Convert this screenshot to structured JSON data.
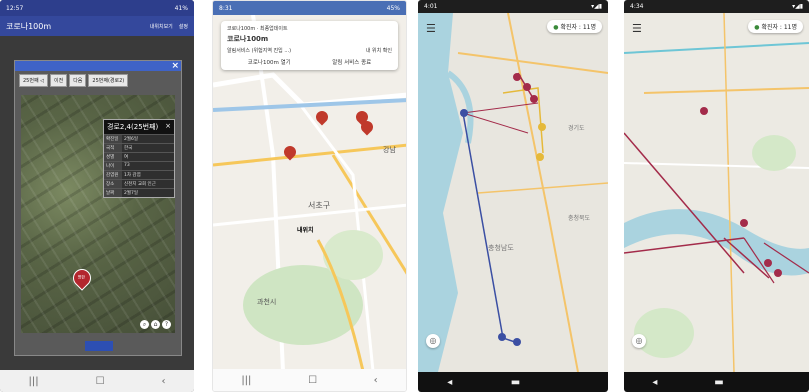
{
  "phone1": {
    "status_time": "12:57",
    "status_right": "41%",
    "app_title": "코로나100m",
    "menu_items": [
      "내위치보기",
      "설정"
    ],
    "nav_prev": "25번째 ◁",
    "nav_buttons": [
      "이전",
      "다음",
      "25번째(경로2)"
    ],
    "info_title": "경로2,4(25번째)",
    "info_rows": [
      {
        "k": "확진일",
        "v": "2월6일"
      },
      {
        "k": "국적",
        "v": "한국"
      },
      {
        "k": "성별",
        "v": "여"
      },
      {
        "k": "나이",
        "v": "73"
      },
      {
        "k": "감염원",
        "v": "1차 감염"
      },
      {
        "k": "장소",
        "v": "신천지 교회 인근"
      },
      {
        "k": "날짜",
        "v": "2월7일"
      }
    ],
    "pin_label": "명한",
    "nav_icons": [
      "|||",
      "☐",
      "‹"
    ]
  },
  "phone2": {
    "status_time": "8:31",
    "status_right": "45%",
    "card_sub": "코로나100m · 최종업데이트",
    "card_title": "코로나100m",
    "card_row_left": "알림서비스 (위험지역 진입 ...)",
    "card_row_right": "내 위치 확인",
    "card_btn1": "코로나100m 열기",
    "card_btn2": "알림 서비스 종료",
    "labels": {
      "east": "강남",
      "district": "서초구",
      "center": "내위치",
      "south": "과천시"
    },
    "nav_icons": [
      "|||",
      "☐",
      "‹"
    ]
  },
  "phone3": {
    "status_time": "4:01",
    "confirm_label": "확진자 : 11명",
    "region_labels": [
      "경기도",
      "충청남도",
      "충청북도"
    ],
    "nav_icons": [
      "◂",
      "▬"
    ]
  },
  "phone4": {
    "status_time": "4:34",
    "confirm_label": "확진자 : 11명",
    "nav_icons": [
      "◂",
      "▬"
    ]
  },
  "colors": {
    "pin_red": "#c0392b",
    "route_blue": "#3b4fa3",
    "route_red": "#a32b4a",
    "route_yellow": "#e5b93a"
  }
}
